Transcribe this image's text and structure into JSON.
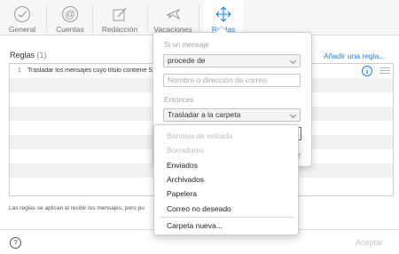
{
  "toolbar": {
    "tabs": [
      {
        "label": "General",
        "icon": "checkmark-circle-icon"
      },
      {
        "label": "Cuentas",
        "icon": "at-sign-icon"
      },
      {
        "label": "Redacción",
        "icon": "compose-icon"
      },
      {
        "label": "Vacaciones",
        "icon": "airplane-icon"
      },
      {
        "label": "Reglas",
        "icon": "arrows-move-icon"
      }
    ],
    "active_tab": "Reglas",
    "accent_color": "#1a82fb"
  },
  "rules": {
    "title": "Reglas",
    "count": "(1)",
    "add_link": "Añadir una regla...",
    "items": [
      {
        "number": "1",
        "text": "Trasladar los mensajes cuyo título contiene S"
      }
    ],
    "footnote": "Las reglas se aplican al recibir los mensajes, pero pu"
  },
  "popover": {
    "if_label": "Si un mensaje",
    "condition_select": "procede de",
    "address_placeholder": "Nombre o dirección de correo",
    "then_label": "Entonces",
    "action_select": "Trasladar a la carpeta"
  },
  "dropdown": {
    "disabled_items": [
      "Bandeja de entrada",
      "Borradores"
    ],
    "items": [
      "Enviados",
      "Archivados",
      "Papelera",
      "Correo no deseado"
    ],
    "new_folder": "Carpeta nueva..."
  },
  "footer": {
    "help_icon": "question-mark-icon",
    "help_glyph": "?",
    "accept_label": "Aceptar"
  }
}
